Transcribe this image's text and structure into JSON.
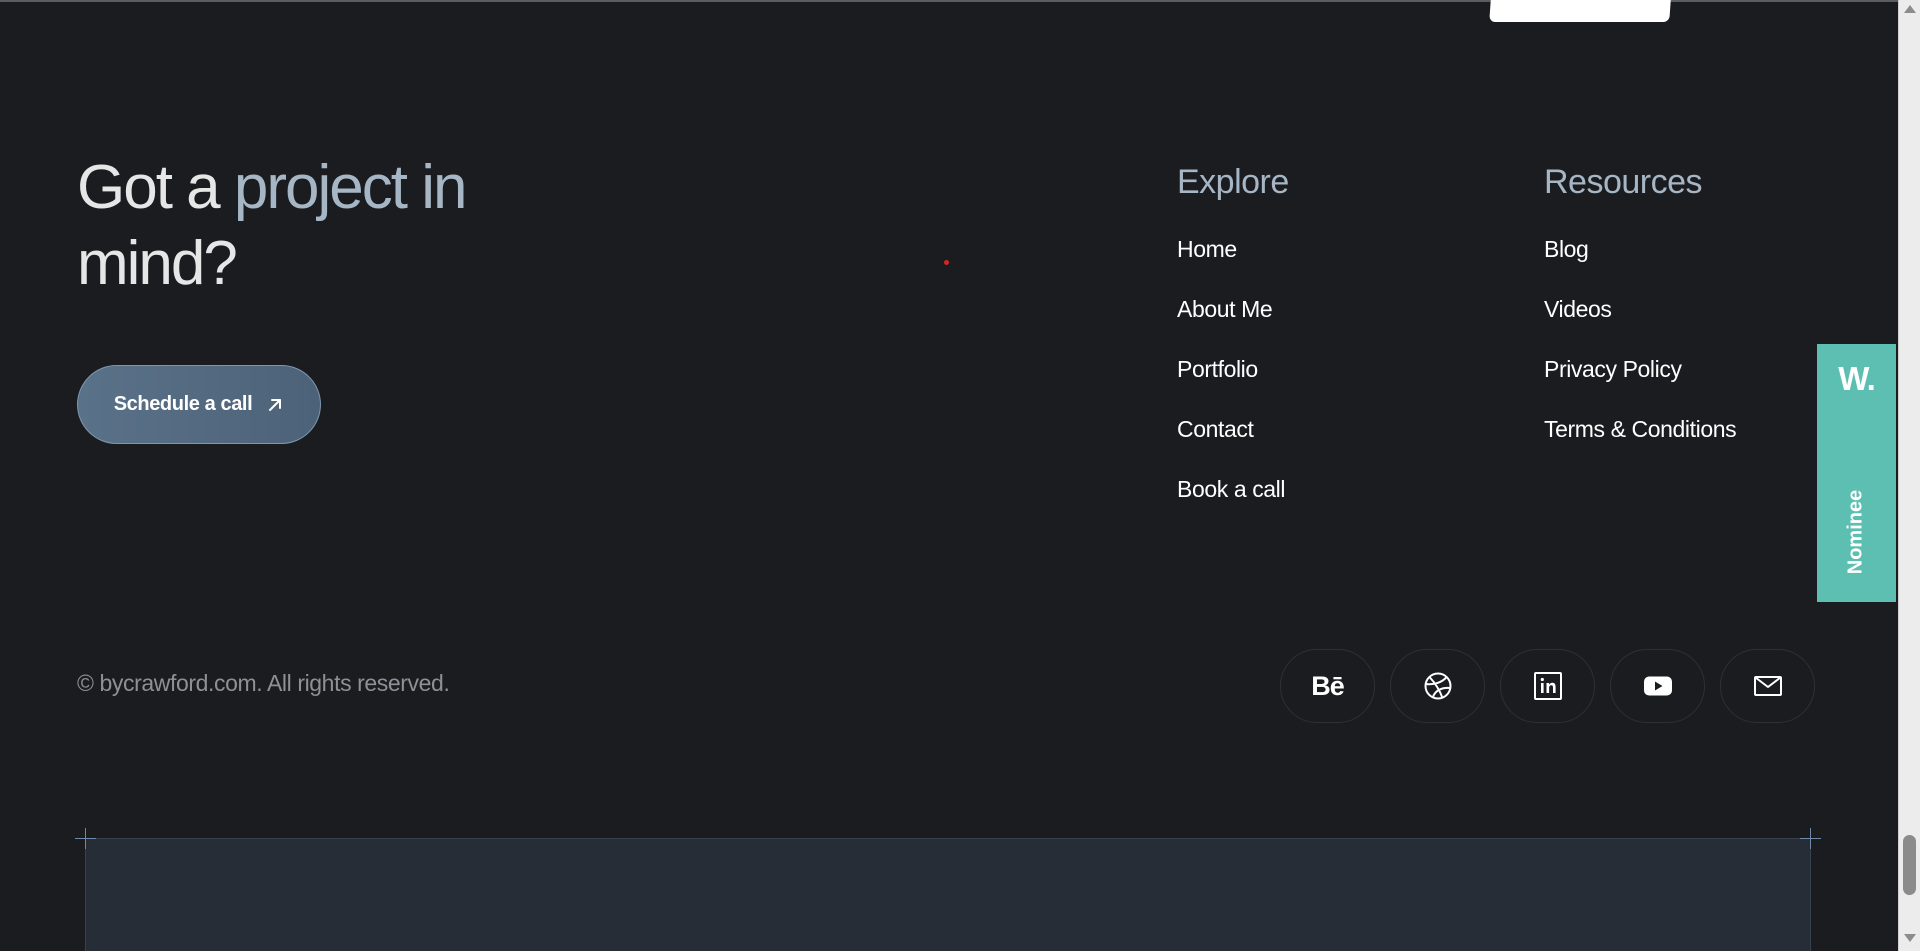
{
  "headline": {
    "part1": "Got a ",
    "part2": "project in",
    "part3": "mind?"
  },
  "cta": {
    "label": "Schedule a call"
  },
  "explore": {
    "title": "Explore",
    "links": [
      "Home",
      "About Me",
      "Portfolio",
      "Contact",
      "Book a call"
    ]
  },
  "resources": {
    "title": "Resources",
    "links": [
      "Blog",
      "Videos",
      "Privacy Policy",
      "Terms & Conditions"
    ]
  },
  "footer": {
    "copyright": "© bycrawford.com. All rights reserved."
  },
  "socials": {
    "behance_label": "Bē",
    "icons": [
      "behance-icon",
      "dribbble-icon",
      "linkedin-icon",
      "youtube-icon",
      "mail-icon"
    ]
  },
  "nominee": {
    "logo": "W.",
    "label": "Nominee"
  },
  "colors": {
    "background": "#1b1c20",
    "accent_muted": "#a6b6c4",
    "cta_bg": "#587087",
    "nominee_bg": "#5cbfb1",
    "panel_bg": "#272d36"
  }
}
